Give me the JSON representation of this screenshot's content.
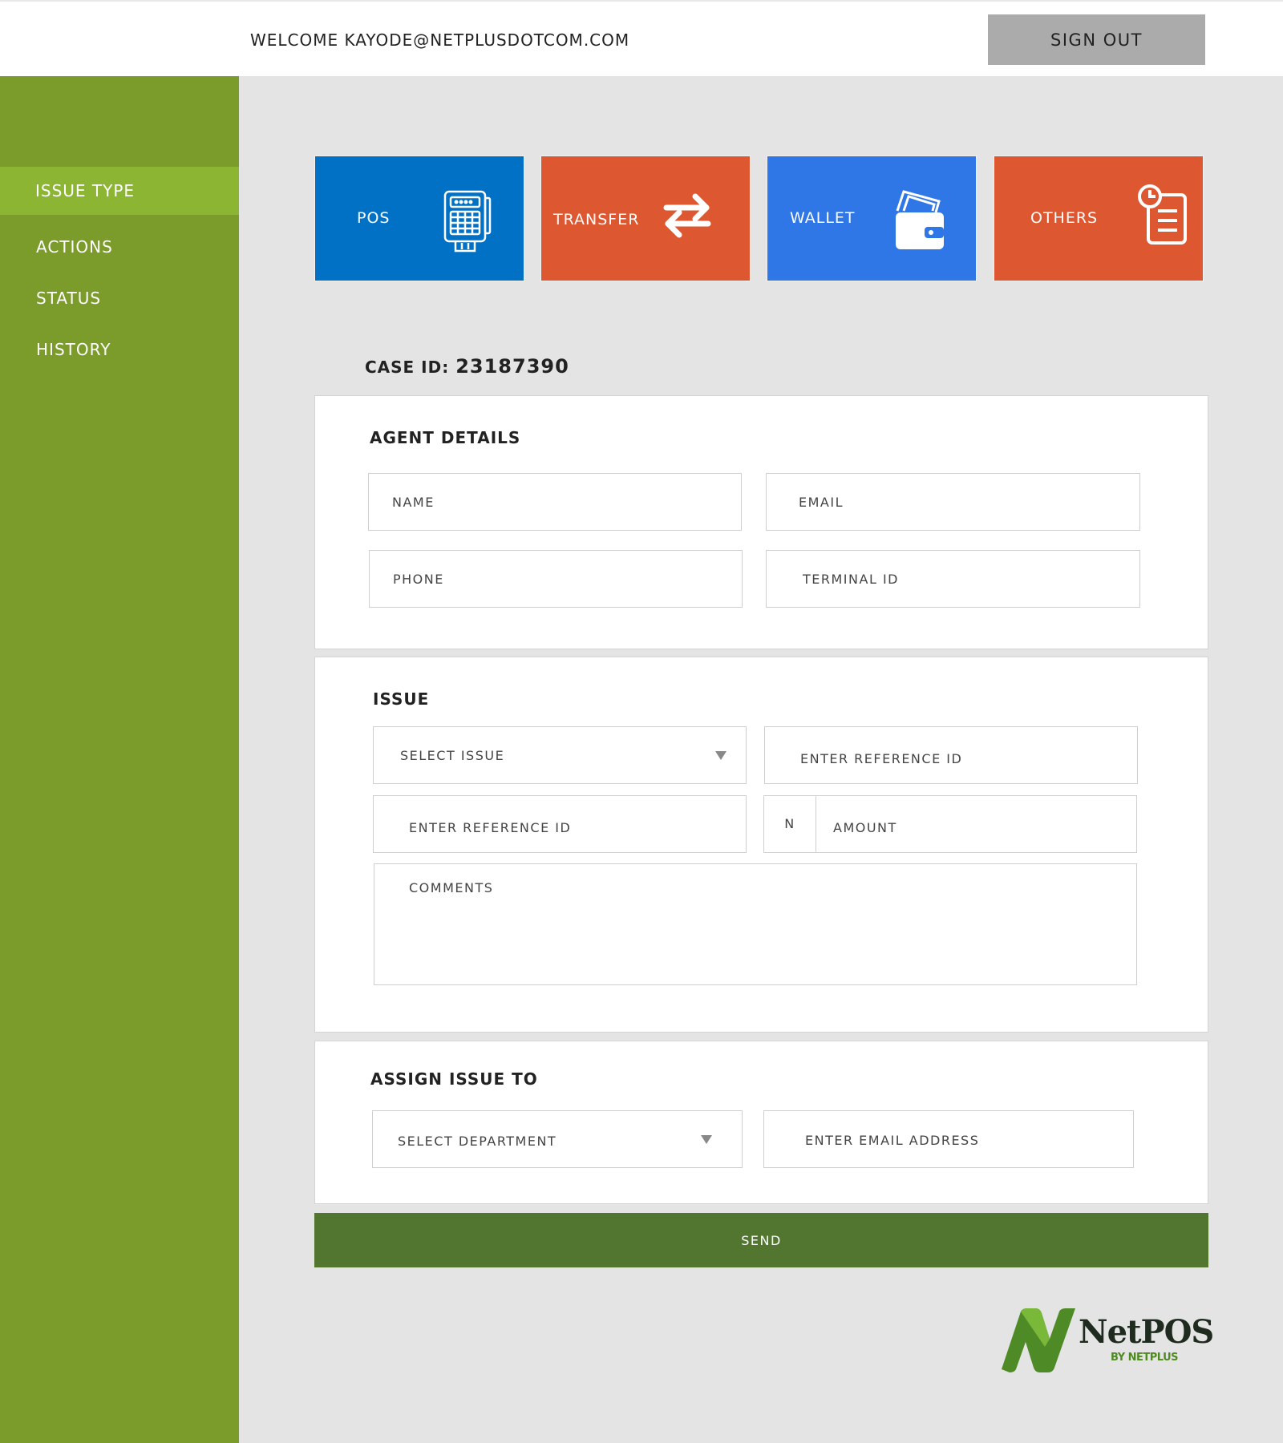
{
  "header": {
    "welcome": "WELCOME KAYODE@NETPLUSDOTCOM.COM",
    "sign_out": "SIGN OUT"
  },
  "sidebar": {
    "items": [
      {
        "label": "ISSUE TYPE",
        "active": true
      },
      {
        "label": "ACTIONS",
        "active": false
      },
      {
        "label": "STATUS",
        "active": false
      },
      {
        "label": "HISTORY",
        "active": false
      }
    ]
  },
  "issue_types": [
    {
      "label": "POS",
      "icon": "pos-terminal-icon",
      "color": "#0071c5"
    },
    {
      "label": "TRANSFER",
      "icon": "transfer-arrows-icon",
      "color": "#dd5730"
    },
    {
      "label": "WALLET",
      "icon": "wallet-icon",
      "color": "#2f77e6"
    },
    {
      "label": "OTHERS",
      "icon": "clipboard-clock-icon",
      "color": "#dd5730"
    }
  ],
  "case": {
    "label": "CASE ID:",
    "id": "23187390"
  },
  "agent_details": {
    "title": "AGENT DETAILS",
    "name_placeholder": "NAME",
    "email_placeholder": "EMAIL",
    "phone_placeholder": "PHONE",
    "terminal_placeholder": "TERMINAL ID"
  },
  "issue": {
    "title": "ISSUE",
    "select_issue": "SELECT ISSUE",
    "reference_placeholder_1": "ENTER REFERENCE ID",
    "reference_placeholder_2": "ENTER REFERENCE ID",
    "currency": "N",
    "amount_placeholder": "AMOUNT",
    "comments_placeholder": "COMMENTS"
  },
  "assign": {
    "title": "ASSIGN ISSUE TO",
    "select_department": "SELECT DEPARTMENT",
    "email_placeholder": "ENTER EMAIL ADDRESS"
  },
  "send_label": "SEND",
  "logo": {
    "brand": "NetPOS",
    "sub": "BY NETPLUS"
  },
  "colors": {
    "sidebar": "#7b9c2a",
    "sidebar_active": "#8db534",
    "send_button": "#527630"
  }
}
